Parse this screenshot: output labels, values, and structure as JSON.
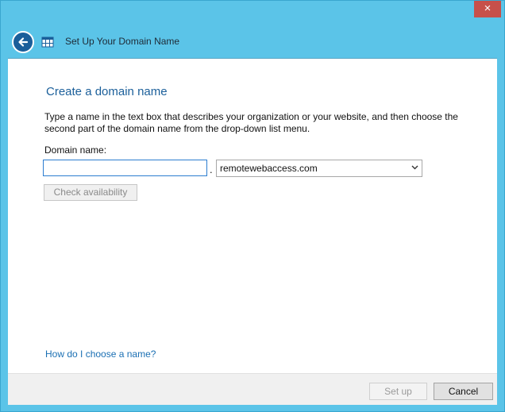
{
  "window": {
    "close_glyph": "×"
  },
  "header": {
    "title": "Set Up Your Domain Name",
    "back_icon": "arrow-left-icon",
    "app_icon": "grid-window-icon"
  },
  "main": {
    "heading": "Create a domain name",
    "description": "Type a name in the text box that describes your organization or your website, and then choose the second part of the domain name from the drop-down list menu.",
    "domain_label": "Domain name:",
    "domain_value": "",
    "separator": ".",
    "domain_suffix_selected": "remotewebaccess.com",
    "check_button_label": "Check availability",
    "help_link": "How do I choose a name?"
  },
  "footer": {
    "setup_label": "Set up",
    "cancel_label": "Cancel"
  },
  "colors": {
    "frame": "#5bc4e8",
    "accent": "#1b5f9a",
    "close": "#c7504a"
  }
}
